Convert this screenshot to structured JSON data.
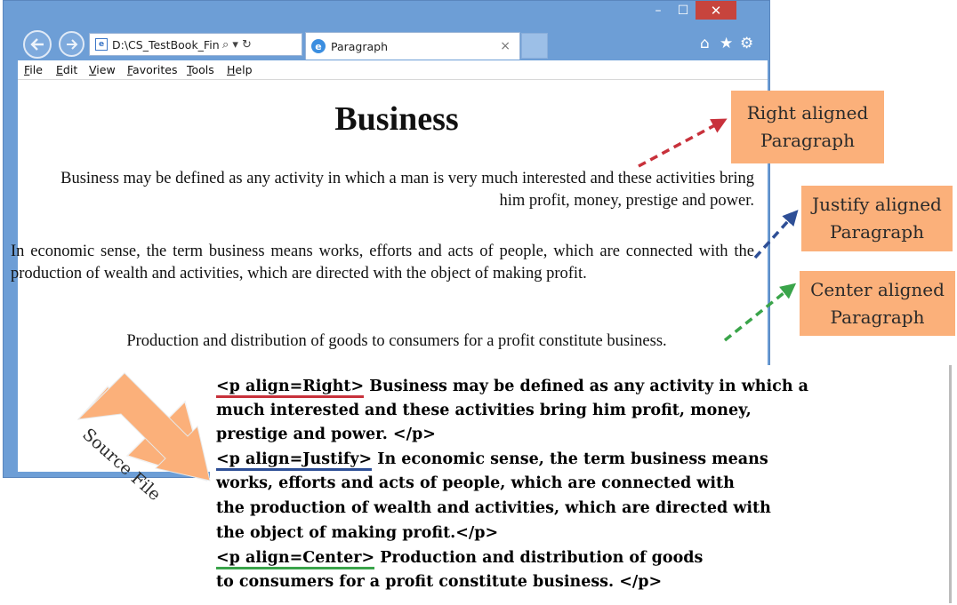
{
  "window": {
    "controls": {
      "minimize": "–",
      "maximize": "☐",
      "close": "✕"
    },
    "nav": {
      "back_icon": "arrow-left-icon",
      "forward_icon": "arrow-right-icon"
    },
    "address_bar": {
      "url": "D:\\CS_TestBook_Final\\",
      "search_glyph": "⌕ ▾",
      "refresh_glyph": "↻"
    },
    "tab": {
      "title": "Paragraph",
      "close_glyph": "×"
    },
    "toolbar_icons": {
      "home": "⌂",
      "favorites": "★",
      "settings": "⚙"
    },
    "menu": [
      "File",
      "Edit",
      "View",
      "Favorites",
      "Tools",
      "Help"
    ]
  },
  "page": {
    "heading": "Business",
    "para_right": "Business may be defined as any activity in which a man is very much interested and these activities bring him profit, money, prestige and power.",
    "para_justify": "In economic sense, the term business means works, efforts and acts of people, which are connected with the production of wealth and activities, which are directed with the object of making profit.",
    "para_center": "Production and distribution of goods to consumers for a profit constitute business."
  },
  "callouts": {
    "right": [
      "Right aligned",
      "Paragraph"
    ],
    "justify": [
      "Justify aligned",
      "Paragraph"
    ],
    "center": [
      "Center aligned",
      "Paragraph"
    ],
    "source": "Source File"
  },
  "source_code": {
    "line1_tag": "<p align=Right>",
    "line1_rest": " Business may be defined as any activity in which a",
    "line2": " much interested and these activities bring him profit, money,",
    "line3": "prestige and power. </p>",
    "line4_tag": "<p align=Justify>",
    "line4_rest": " In economic sense, the term business means",
    "line5": "works, efforts and acts of people, which are connected with",
    "line6": "the production of wealth and activities, which are directed with",
    "line7": "the object of making profit.</p>",
    "line8_tag": "<p align=Center>",
    "line8_rest": " Production and distribution of goods",
    "line9": "to consumers for a profit constitute business. </p>"
  },
  "colors": {
    "right_arrow": "#c8313b",
    "justify_arrow": "#2e4f96",
    "center_arrow": "#3aa44a",
    "callout_fill": "#fbb07a",
    "window_frame": "#6d9ed6"
  }
}
